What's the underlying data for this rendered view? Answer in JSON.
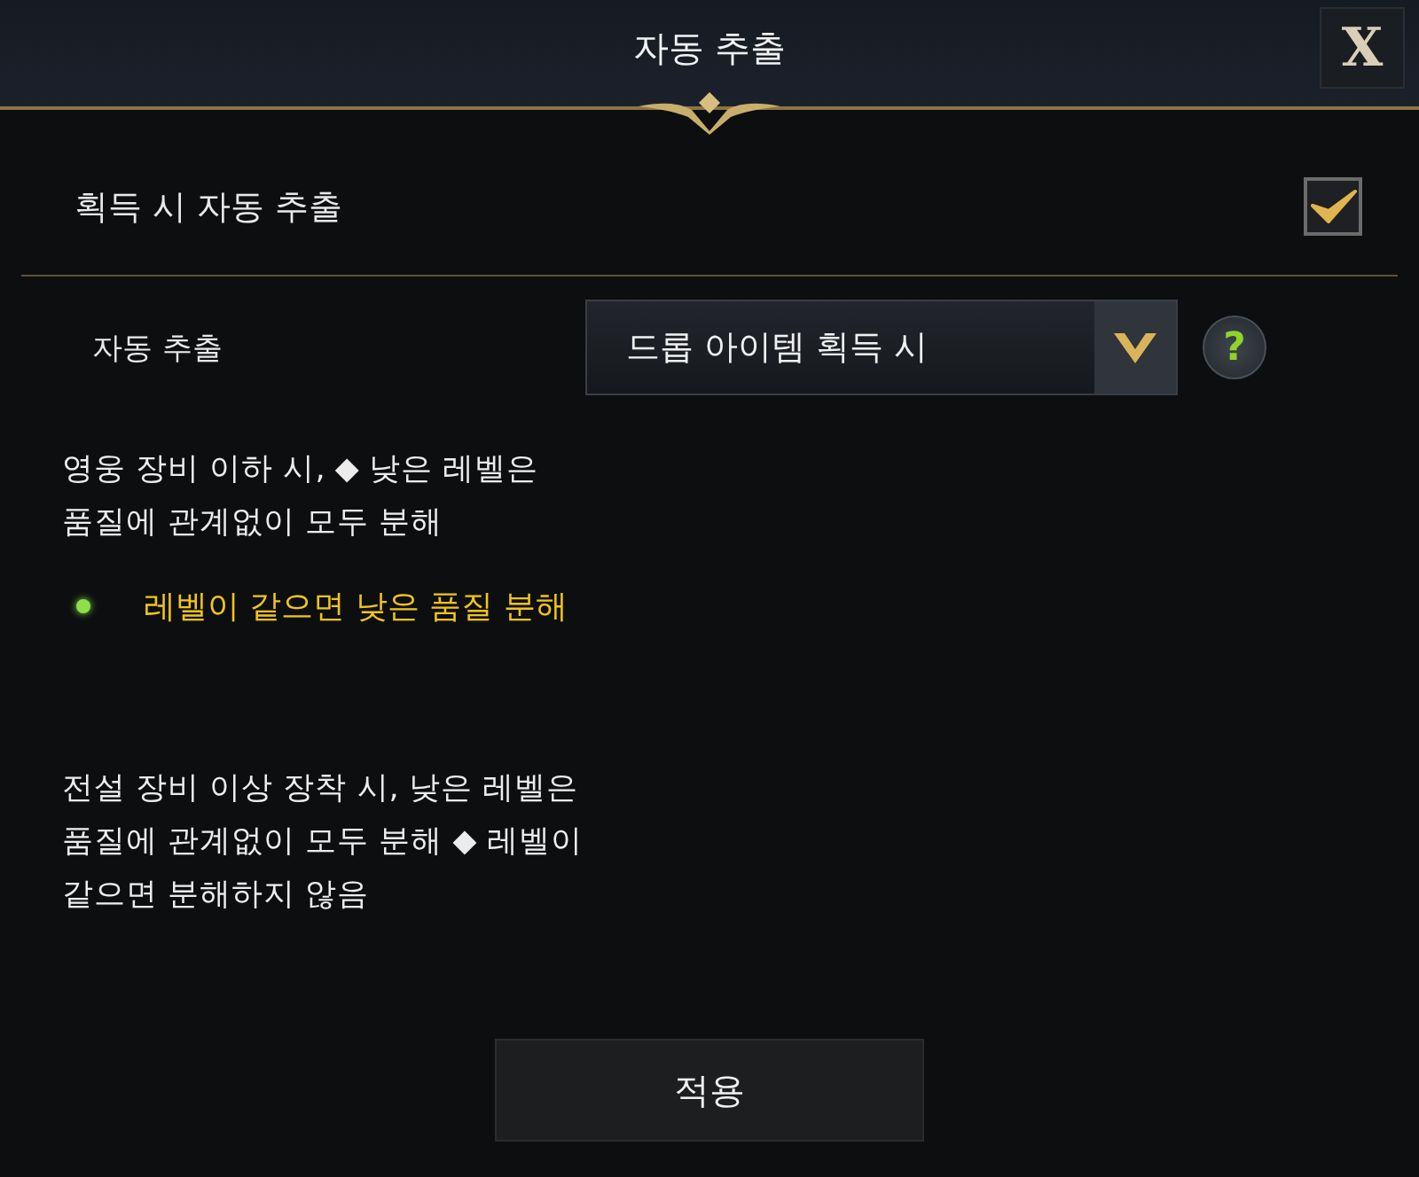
{
  "window": {
    "title": "자동 추출",
    "close": "X"
  },
  "auto_extract_on_acquire": {
    "label": "획득 시 자동 추출",
    "checked": true
  },
  "auto_extract": {
    "label": "자동 추출",
    "value": "드롭 아이템 획득 시",
    "help": "?"
  },
  "notes": [
    {
      "kind": "plain",
      "text": "영웅 장비 이하 시, ◆ 낮은 레벨은\n품질에 관계없이 모두 분해"
    },
    {
      "kind": "bullet",
      "text": "레벨이 같으면 낮은 품질 분해"
    },
    {
      "kind": "plain",
      "text": "전설 장비 이상 장착 시, 낮은 레벨은\n품질에 관계없이 모두 분해 ◆ 레벨이\n같으면 분해하지 않음"
    }
  ],
  "apply_button": "적용"
}
